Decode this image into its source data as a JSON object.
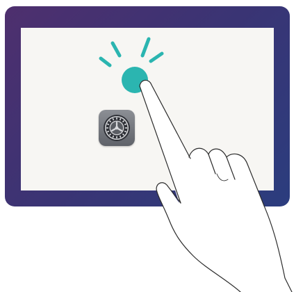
{
  "illustration": {
    "subject": "tap-on-screen",
    "icons": {
      "app": "settings-gear-icon",
      "tap": "tap-ripple-icon",
      "hand": "pointing-hand-icon"
    },
    "colors": {
      "device_frame_start": "#4e2f6e",
      "device_frame_end": "#2b3d7e",
      "screen": "#f7f6f3",
      "tap_accent": "#2bb5b0",
      "app_icon": "#6f7279",
      "hand_outline": "#2b2b2b"
    }
  }
}
